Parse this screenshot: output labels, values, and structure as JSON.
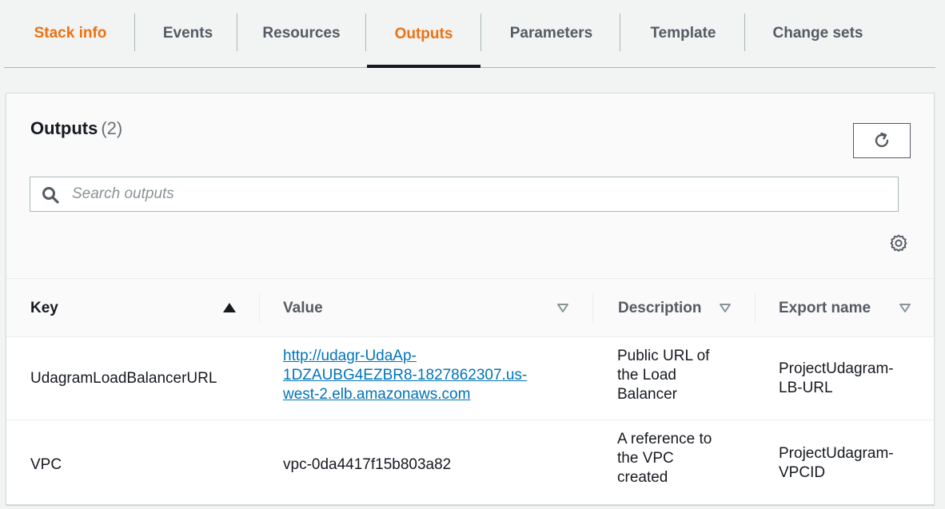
{
  "tabs": [
    {
      "label": "Stack info"
    },
    {
      "label": "Events"
    },
    {
      "label": "Resources"
    },
    {
      "label": "Outputs"
    },
    {
      "label": "Parameters"
    },
    {
      "label": "Template"
    },
    {
      "label": "Change sets"
    }
  ],
  "panel": {
    "title": "Outputs",
    "count": "(2)"
  },
  "search": {
    "placeholder": "Search outputs"
  },
  "table": {
    "columns": [
      "Key",
      "Value",
      "Description",
      "Export name"
    ],
    "rows": [
      {
        "key": "UdagramLoadBalancerURL",
        "value_lines": [
          "http://udagr-UdaAp-",
          "1DZAUBG4EZBR8-1827862307.us-",
          "west-2.elb.amazonaws.com"
        ],
        "description_lines": [
          "Public URL of",
          "the Load",
          "Balancer"
        ],
        "export_lines": [
          "ProjectUdagram-",
          "LB-URL"
        ]
      },
      {
        "key": "VPC",
        "value": "vpc-0da4417f15b803a82",
        "description_lines": [
          "A reference to",
          "the VPC",
          "created"
        ],
        "export_lines": [
          "ProjectUdagram-",
          "VPCID"
        ]
      }
    ]
  },
  "colors": {
    "accent": "#ec7211",
    "link": "#0073bb",
    "text": "#16191f",
    "muted": "#545b64"
  }
}
